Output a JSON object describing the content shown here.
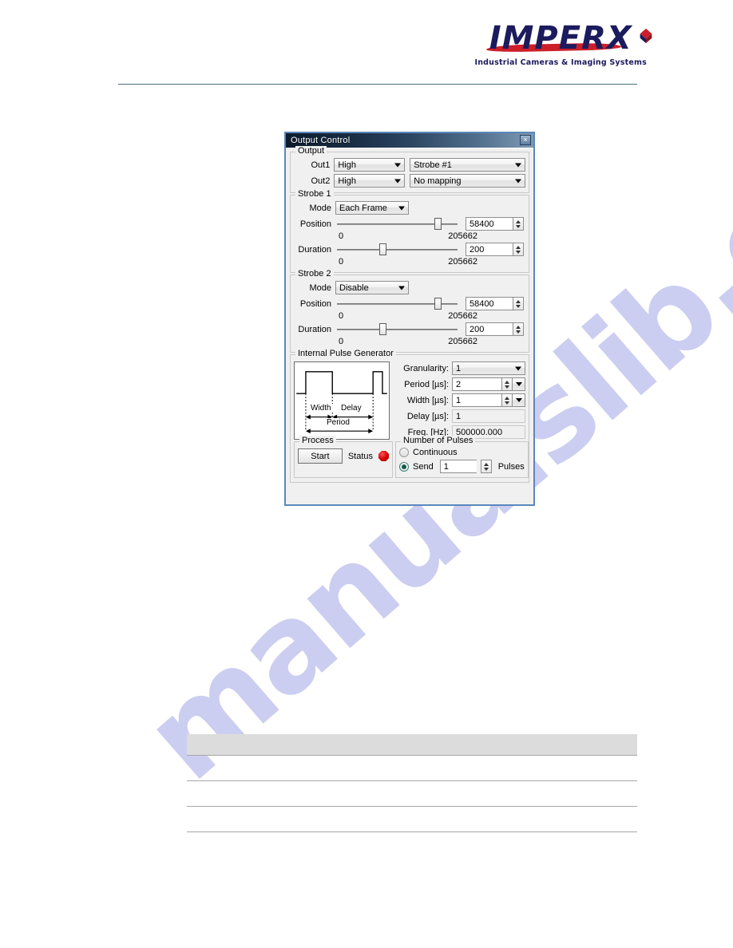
{
  "header": {
    "logo_wordmark": "IMPERX",
    "logo_tagline": "Industrial Cameras & Imaging Systems"
  },
  "watermark": {
    "text": "manualslib.com"
  },
  "dialog": {
    "title": "Output Control",
    "close_label": "×",
    "output_group": {
      "title": "Output",
      "rows": [
        {
          "label": "Out1",
          "polarity": "High",
          "mapping": "Strobe #1"
        },
        {
          "label": "Out2",
          "polarity": "High",
          "mapping": "No mapping"
        }
      ]
    },
    "strobe1": {
      "title": "Strobe 1",
      "mode_label": "Mode",
      "mode_value": "Each Frame",
      "position_label": "Position",
      "position_value": "58400",
      "position_min": "0",
      "position_max": "205662",
      "position_pct": 85,
      "duration_label": "Duration",
      "duration_value": "200",
      "duration_min": "0",
      "duration_max": "205662",
      "duration_pct": 38
    },
    "strobe2": {
      "title": "Strobe 2",
      "mode_label": "Mode",
      "mode_value": "Disable",
      "position_label": "Position",
      "position_value": "58400",
      "position_min": "0",
      "position_max": "205662",
      "position_pct": 85,
      "duration_label": "Duration",
      "duration_value": "200",
      "duration_min": "0",
      "duration_max": "205662",
      "duration_pct": 38
    },
    "pulse_generator": {
      "title": "Internal Pulse Generator",
      "diagram": {
        "width_label": "Width",
        "delay_label": "Delay",
        "period_label": "Period"
      },
      "granularity_label": "Granularity:",
      "granularity_value": "1",
      "period_label": "Period [µs]:",
      "period_value": "2",
      "width_label": "Width [µs]:",
      "width_value": "1",
      "delay_label": "Delay [µs]:",
      "delay_value": "1",
      "freq_label": "Freq. [Hz]:",
      "freq_value": "500000.000"
    },
    "process": {
      "title": "Process",
      "start_label": "Start",
      "status_label": "Status",
      "status_color": "#d40000"
    },
    "pulses": {
      "title": "Number of Pulses",
      "continuous_label": "Continuous",
      "continuous_selected": false,
      "send_label": "Send",
      "send_selected": true,
      "send_value": "1",
      "send_unit": "Pulses"
    }
  },
  "bottom_table": {
    "header_cells": [
      "",
      "",
      ""
    ],
    "rows": [
      [
        "",
        "",
        ""
      ],
      [
        "",
        "",
        ""
      ],
      [
        "",
        "",
        ""
      ]
    ]
  }
}
